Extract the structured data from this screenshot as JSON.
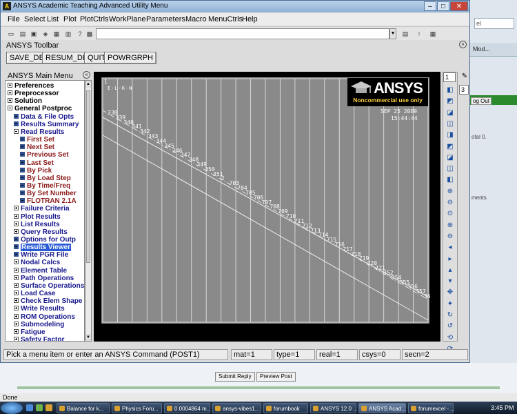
{
  "window": {
    "title": "ANSYS Academic Teaching Advanced Utility Menu",
    "controls": {
      "minimize": "–",
      "maximize": "□",
      "close": "✕"
    }
  },
  "menubar": [
    "File",
    "Select",
    "List",
    "Plot",
    "PlotCtrls",
    "WorkPlane",
    "Parameters",
    "Macro",
    "MenuCtrls",
    "Help"
  ],
  "command_input": {
    "value": ""
  },
  "ansys_toolbar": {
    "label": "ANSYS Toolbar",
    "buttons": [
      "SAVE_DB",
      "RESUM_DB",
      "QUIT",
      "POWRGRPH"
    ]
  },
  "main_menu": {
    "label": "ANSYS Main Menu",
    "items": [
      {
        "label": "Preferences",
        "level": 0,
        "box": "plus"
      },
      {
        "label": "Preprocessor",
        "level": 0,
        "box": "plus"
      },
      {
        "label": "Solution",
        "level": 0,
        "box": "plus"
      },
      {
        "label": "General Postproc",
        "level": 0,
        "box": "minus"
      },
      {
        "label": "Data & File Opts",
        "level": 1,
        "box": "leaf"
      },
      {
        "label": "Results Summary",
        "level": 1,
        "box": "leaf"
      },
      {
        "label": "Read Results",
        "level": 1,
        "box": "minus"
      },
      {
        "label": "First Set",
        "level": 2,
        "box": "leaf"
      },
      {
        "label": "Next Set",
        "level": 2,
        "box": "leaf"
      },
      {
        "label": "Previous Set",
        "level": 2,
        "box": "leaf"
      },
      {
        "label": "Last Set",
        "level": 2,
        "box": "leaf"
      },
      {
        "label": "By Pick",
        "level": 2,
        "box": "leaf"
      },
      {
        "label": "By Load Step",
        "level": 2,
        "box": "leaf"
      },
      {
        "label": "By Time/Freq",
        "level": 2,
        "box": "leaf"
      },
      {
        "label": "By Set Number",
        "level": 2,
        "box": "leaf"
      },
      {
        "label": "FLOTRAN 2.1A",
        "level": 2,
        "box": "leaf"
      },
      {
        "label": "Failure Criteria",
        "level": 1,
        "box": "plus"
      },
      {
        "label": "Plot Results",
        "level": 1,
        "box": "plus"
      },
      {
        "label": "List Results",
        "level": 1,
        "box": "plus"
      },
      {
        "label": "Query Results",
        "level": 1,
        "box": "plus"
      },
      {
        "label": "Options for Outp",
        "level": 1,
        "box": "leaf"
      },
      {
        "label": "Results Viewer",
        "level": 1,
        "box": "leaf",
        "selected": true
      },
      {
        "label": "Write PGR File",
        "level": 1,
        "box": "leaf"
      },
      {
        "label": "Nodal Calcs",
        "level": 1,
        "box": "plus"
      },
      {
        "label": "Element Table",
        "level": 1,
        "box": "plus"
      },
      {
        "label": "Path Operations",
        "level": 1,
        "box": "plus"
      },
      {
        "label": "Surface Operations",
        "level": 1,
        "box": "plus"
      },
      {
        "label": "Load Case",
        "level": 1,
        "box": "plus"
      },
      {
        "label": "Check Elem Shape",
        "level": 1,
        "box": "plus"
      },
      {
        "label": "Write Results",
        "level": 1,
        "box": "plus"
      },
      {
        "label": "ROM Operations",
        "level": 1,
        "box": "plus"
      },
      {
        "label": "Submodeling",
        "level": 1,
        "box": "plus"
      },
      {
        "label": "Fatigue",
        "level": 1,
        "box": "plus"
      },
      {
        "label": "Safety Factor",
        "level": 1,
        "box": "plus"
      }
    ]
  },
  "graphics": {
    "window_number": "1",
    "plot_label": "E-L-K-N",
    "date": "SEP 25 2009",
    "time": "15:44:44",
    "logo": {
      "word": "ANSYS",
      "subtitle": "Noncommercial use only"
    },
    "node_labels": [
      "338",
      "339",
      "340",
      "341",
      "342",
      "343",
      "344",
      "345",
      "346",
      "347",
      "348",
      "349",
      "350",
      "351",
      "2",
      "703",
      "704",
      "705",
      "706",
      "707",
      "708",
      "709",
      "710",
      "711",
      "712",
      "713",
      "714",
      "715",
      "716",
      "717",
      "718",
      "719",
      "720",
      "721",
      "352",
      "354",
      "355",
      "356",
      "357",
      "35"
    ]
  },
  "right_toolbar": {
    "view_number": "1",
    "side_number": "3"
  },
  "status_bar": {
    "prompt": "Pick a menu item or enter an ANSYS Command (POST1)",
    "mat": "mat=1",
    "type": "type=1",
    "real": "real=1",
    "csys": "csys=0",
    "secn": "secn=2"
  },
  "background_browser": {
    "search_text": "el",
    "tab_text": "Mod...",
    "logout": "og Out",
    "side_text1": "otal 0.",
    "side_text2": "ments",
    "buttons": [
      "Submit Reply",
      "Preview Post"
    ],
    "status": "Done"
  },
  "taskbar": {
    "items": [
      {
        "label": "Balance for k...",
        "active": false
      },
      {
        "label": "Physics Foru...",
        "active": false
      },
      {
        "label": "0.0004864 m...",
        "active": false
      },
      {
        "label": "ansys-vibes1...",
        "active": false
      },
      {
        "label": "forumbook",
        "active": false
      },
      {
        "label": "ANSYS 12.0 ...",
        "active": false
      },
      {
        "label": "ANSYS Acad...",
        "active": true
      },
      {
        "label": "forumexcel -...",
        "active": false
      }
    ],
    "clock": "3:45 PM"
  }
}
